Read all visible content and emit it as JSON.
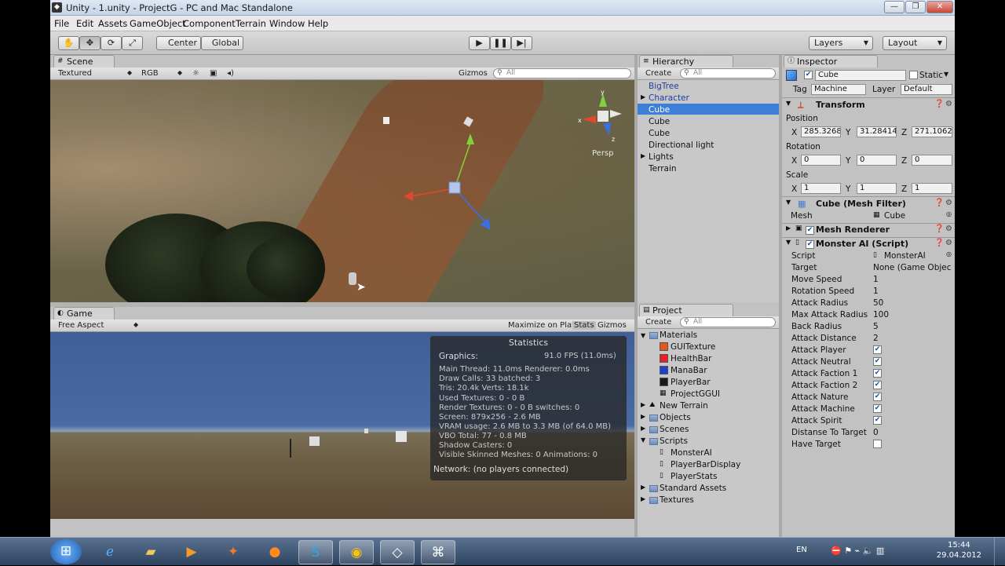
{
  "window": {
    "title": "Unity - 1.unity - ProjectG - PC and Mac Standalone"
  },
  "menu": [
    "File",
    "Edit",
    "Assets",
    "GameObject",
    "Component",
    "Terrain",
    "Window",
    "Help"
  ],
  "toolbar": {
    "center": "Center",
    "global": "Global",
    "layers": "Layers",
    "layout": "Layout"
  },
  "scene": {
    "tab": "Scene",
    "shading": "Textured",
    "render": "RGB",
    "gizmos": "Gizmos",
    "search_placeholder": "All",
    "persp": "Persp",
    "axis_x": "x",
    "axis_y": "y",
    "axis_z": "z"
  },
  "game": {
    "tab": "Game",
    "aspect": "Free Aspect",
    "maximize": "Maximize on Play",
    "stats": "Stats",
    "gizmos": "Gizmos",
    "statistics": {
      "title": "Statistics",
      "graphics_label": "Graphics:",
      "fps": "91.0 FPS (11.0ms)",
      "lines": [
        "Main Thread: 11.0ms  Renderer: 0.0ms",
        "Draw Calls: 33    batched: 3",
        "Tris: 20.4k   Verts: 18.1k",
        "Used Textures: 0 - 0 B",
        "Render Textures: 0 - 0 B  switches: 0",
        "Screen: 879x256 - 2.6 MB",
        "VRAM usage: 2.6 MB to 3.3 MB (of 64.0 MB)",
        "VBO Total: 77 - 0.8 MB",
        "Shadow Casters: 0",
        "Visible Skinned Meshes: 0     Animations: 0"
      ],
      "network": "Network: (no players connected)"
    }
  },
  "hierarchy": {
    "tab": "Hierarchy",
    "create": "Create",
    "search_placeholder": "All",
    "items": [
      "BigTree",
      "Character",
      "Cube",
      "Cube",
      "Cube",
      "Directional light",
      "Lights",
      "Terrain"
    ]
  },
  "project": {
    "tab": "Project",
    "create": "Create",
    "search_placeholder": "All",
    "items": [
      "Materials",
      "GUITexture",
      "HealthBar",
      "ManaBar",
      "PlayerBar",
      "ProjectGGUI",
      "New Terrain",
      "Objects",
      "Scenes",
      "Scripts",
      "MonsterAI",
      "PlayerBarDisplay",
      "PlayerStats",
      "Standard Assets",
      "Textures"
    ],
    "colors": {
      "gui": "#e2561f",
      "health": "#e5212a",
      "mana": "#2140c9",
      "player": "#1a1a1a"
    }
  },
  "inspector": {
    "tab": "Inspector",
    "name": "Cube",
    "static": "Static",
    "tag_label": "Tag",
    "tag": "Machine",
    "layer_label": "Layer",
    "layer": "Default",
    "transform": {
      "title": "Transform",
      "position_label": "Position",
      "rotation_label": "Rotation",
      "scale_label": "Scale",
      "x": "X",
      "y": "Y",
      "z": "Z",
      "position": [
        "285.3268",
        "31.28414",
        "271.1062"
      ],
      "rotation": [
        "0",
        "0",
        "0"
      ],
      "scale": [
        "1",
        "1",
        "1"
      ]
    },
    "mesh_filter": {
      "title": "Cube (Mesh Filter)",
      "mesh_label": "Mesh",
      "mesh": "Cube"
    },
    "mesh_renderer": {
      "title": "Mesh Renderer"
    },
    "monster_ai": {
      "title": "Monster AI (Script)",
      "script_label": "Script",
      "script": "MonsterAI",
      "fields": [
        {
          "label": "Target",
          "value": "None (Game Objec"
        },
        {
          "label": "Move Speed",
          "value": "1"
        },
        {
          "label": "Rotation Speed",
          "value": "1"
        },
        {
          "label": "Attack Radius",
          "value": "50"
        },
        {
          "label": "Max Attack Radius",
          "value": "100"
        },
        {
          "label": "Back Radius",
          "value": "5"
        },
        {
          "label": "Attack Distance",
          "value": "2"
        }
      ],
      "checks": [
        {
          "label": "Attack Player",
          "checked": true
        },
        {
          "label": "Attack Neutral",
          "checked": true
        },
        {
          "label": "Attack Faction 1",
          "checked": true
        },
        {
          "label": "Attack Faction 2",
          "checked": true
        },
        {
          "label": "Attack Nature",
          "checked": true
        },
        {
          "label": "Attack Machine",
          "checked": true
        },
        {
          "label": "Attack Spirit",
          "checked": true
        }
      ],
      "distance_label": "Distanse To Target",
      "distance": "0",
      "have_target_label": "Have Target"
    }
  },
  "taskbar": {
    "lang": "EN",
    "time": "15:44",
    "date": "29.04.2012"
  }
}
